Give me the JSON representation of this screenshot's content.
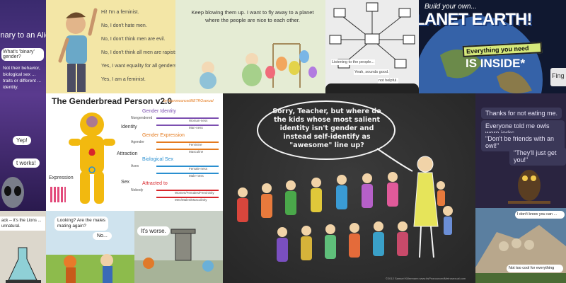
{
  "alien": {
    "title": "inary to an Alien",
    "bubble1": "What's 'binary' gender?",
    "body": "Not their behavior, biological sex ... traits or different ... identity.",
    "bubble2": "Yep!",
    "bubble3": "t works!"
  },
  "feminism": {
    "lines": [
      "Hi! I'm a feminist.",
      "No, I don't hate men.",
      "No, I don't think men are evil.",
      "No, I don't think all men are rapists.",
      "Yes, I want equality for all genders.",
      "Yes, I am a feminist."
    ]
  },
  "balloon": {
    "caption": "Keep blowing them up. I want to fly away to a planet where the people are nice to each other."
  },
  "network": {
    "captions": [
      "Listening to the people...",
      "Yeah, sounds good.",
      "not helpful."
    ]
  },
  "earth": {
    "top": "Build your own...",
    "big": "LANET EARTH!",
    "everything": "Everything you need",
    "inside": "IS INSIDE",
    "asterisk": "*",
    "side": "Fing"
  },
  "genderbread": {
    "title": "The Genderbread Person v2.0",
    "by": "by itspronouncedMETROsexual",
    "labels": [
      "Identity",
      "Attraction",
      "Expression",
      "Sex"
    ],
    "sections": [
      {
        "title": "Gender Identity",
        "left": "Woman-ness",
        "right": "Man-ness",
        "color": "#7c4fb0"
      },
      {
        "title": "Gender Expression",
        "left": "Feminine",
        "right": "Masculine",
        "color": "#e47a1e"
      },
      {
        "title": "Biological Sex",
        "left": "Female-ness",
        "right": "Male-ness",
        "color": "#2a8fd0"
      },
      {
        "title": "Attracted to",
        "left": "Women/Females/Femininity",
        "right": "Men/Males/Masculinity",
        "color": "#d8262b"
      }
    ],
    "side_words": [
      "Nongendered",
      "Agender",
      "Asex",
      "Nobody"
    ]
  },
  "teacher": {
    "speech": "Sorry, Teacher, but where do the kids whose most salient identity isn't gender and instead self-identify as \"awesome\" line up?",
    "footer": "©2012 Samuel Killermann  www.itsPronouncedMetrosexual.com"
  },
  "owl": {
    "messages": [
      "Thanks for not eating me.",
      "Everyone told me owls were jerks.",
      "\"Don't be friends with an owl!\"",
      "\"They'll just get you!\""
    ]
  },
  "lions": {
    "text": "ack -- it's the Lions ... unnatural."
  },
  "males": {
    "bubble1": "Looking? Are the males mating again?",
    "bubble2": "No..."
  },
  "worse": {
    "bubble": "It's worse."
  },
  "rush": {
    "bubble1": "I don't know you can ...",
    "bubble2": "Not too cool for everything"
  },
  "colors": {
    "ginger": "#f2b90f",
    "teacher_bg": "#2b2b2b",
    "chalk": "#f4f4f4"
  }
}
